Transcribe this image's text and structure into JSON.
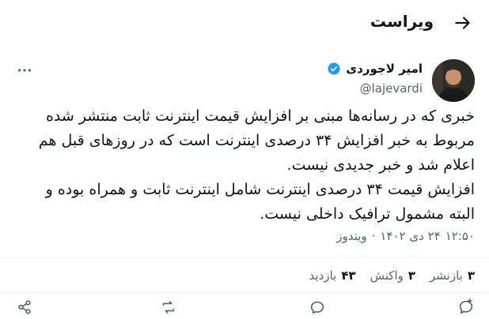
{
  "header": {
    "title": "ویراست"
  },
  "author": {
    "name": "امیر لاجوردی",
    "handle": "@lajevardi"
  },
  "tweet": {
    "lines": [
      "خبری که در رسانه‌ها مبنی بر افزایش قیمت اینترنت ثابت منتشر شده",
      "مربوط به خبر افزایش ۳۴ درصدی اینترنت است که در روزهای قبل هم",
      "اعلام شد و خبر جدیدی نیست.",
      "افزایش قیمت ۳۴ درصدی اینترنت شامل اینترنت ثابت و همراه بوده و",
      "البته مشمول ترافیک داخلی نیست."
    ]
  },
  "meta": {
    "time": "۱۲:۵۰",
    "date": "۲۴ دی ۱۴۰۲",
    "sep": "·",
    "source": "ویندوز"
  },
  "stats": {
    "reposts": {
      "count": "۳",
      "label": "بازنشر"
    },
    "quotes": {
      "count": "۳",
      "label": "واکنش"
    },
    "views": {
      "count": "۴۳",
      "label": "بازدید"
    }
  },
  "icons": {
    "back": "arrow-right-icon",
    "verified": "verified-badge-icon",
    "more": "more-icon",
    "reply": "reply-icon",
    "repost": "repost-icon",
    "like": "like-icon",
    "share": "share-icon"
  },
  "colors": {
    "verified": "#1d9bf0",
    "muted": "#536471",
    "text": "#0f1419"
  }
}
